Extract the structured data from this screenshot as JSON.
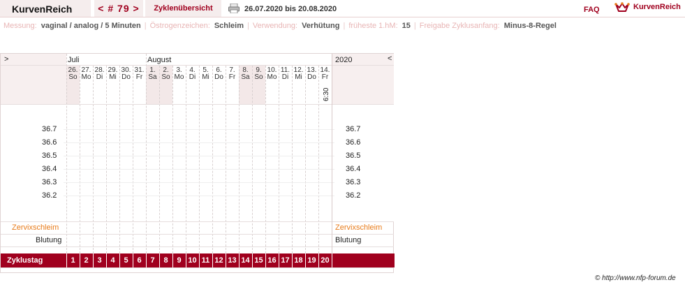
{
  "header": {
    "app_title": "KurvenReich",
    "cycle_nav": "< # 79 >",
    "overview_tab": "Zyklenübersicht",
    "date_range": "26.07.2020 bis 20.08.2020",
    "faq": "FAQ",
    "brand": "KurvenReich",
    "print_icon": "printer-icon",
    "brand_icon": "crown-icon"
  },
  "info": {
    "messung_label": "Messung:",
    "messung_value": "vaginal / analog / 5 Minuten",
    "oestrogen_label": "Östrogenzeichen:",
    "oestrogen_value": "Schleim",
    "verwendung_label": "Verwendung:",
    "verwendung_value": "Verhütung",
    "hm_label": "früheste 1.hM:",
    "hm_value": "15",
    "freigabe_label": "Freigabe Zyklusanfang:",
    "freigabe_value": "Minus-8-Regel"
  },
  "chart": {
    "nav_prev": ">",
    "nav_next": "<",
    "month_july": "Juli",
    "month_august": "August",
    "year": "2020",
    "days": [
      {
        "d": "26.",
        "w": "So",
        "we": true
      },
      {
        "d": "27.",
        "w": "Mo",
        "we": false
      },
      {
        "d": "28.",
        "w": "Di",
        "we": false
      },
      {
        "d": "29.",
        "w": "Mi",
        "we": false
      },
      {
        "d": "30.",
        "w": "Do",
        "we": false
      },
      {
        "d": "31.",
        "w": "Fr",
        "we": false
      },
      {
        "d": "1.",
        "w": "Sa",
        "we": true
      },
      {
        "d": "2.",
        "w": "So",
        "we": true
      },
      {
        "d": "3.",
        "w": "Mo",
        "we": false
      },
      {
        "d": "4.",
        "w": "Di",
        "we": false
      },
      {
        "d": "5.",
        "w": "Mi",
        "we": false
      },
      {
        "d": "6.",
        "w": "Do",
        "we": false
      },
      {
        "d": "7.",
        "w": "Fr",
        "we": false
      },
      {
        "d": "8.",
        "w": "Sa",
        "we": true
      },
      {
        "d": "9.",
        "w": "So",
        "we": true
      },
      {
        "d": "10.",
        "w": "Mo",
        "we": false
      },
      {
        "d": "11.",
        "w": "Di",
        "we": false
      },
      {
        "d": "12.",
        "w": "Mi",
        "we": false
      },
      {
        "d": "13.",
        "w": "Do",
        "we": false
      },
      {
        "d": "14.",
        "w": "Fr",
        "we": false
      }
    ],
    "time_label": "6:30",
    "temps": [
      "36.7",
      "36.6",
      "36.5",
      "36.4",
      "36.3",
      "36.2"
    ],
    "row_cervix": "Zervixschleim",
    "row_blood": "Blutung",
    "cycle_day_label": "Zyklustag",
    "cycle_days": [
      "1",
      "2",
      "3",
      "4",
      "5",
      "6",
      "7",
      "8",
      "9",
      "10",
      "11",
      "12",
      "13",
      "14",
      "15",
      "16",
      "17",
      "18",
      "19",
      "20"
    ],
    "colors": {
      "accent": "#a0001e",
      "cervix": "#e87b1a",
      "weekend": "#f3e8e8"
    }
  },
  "footer": {
    "copyright": "© http://www.nfp-forum.de"
  }
}
